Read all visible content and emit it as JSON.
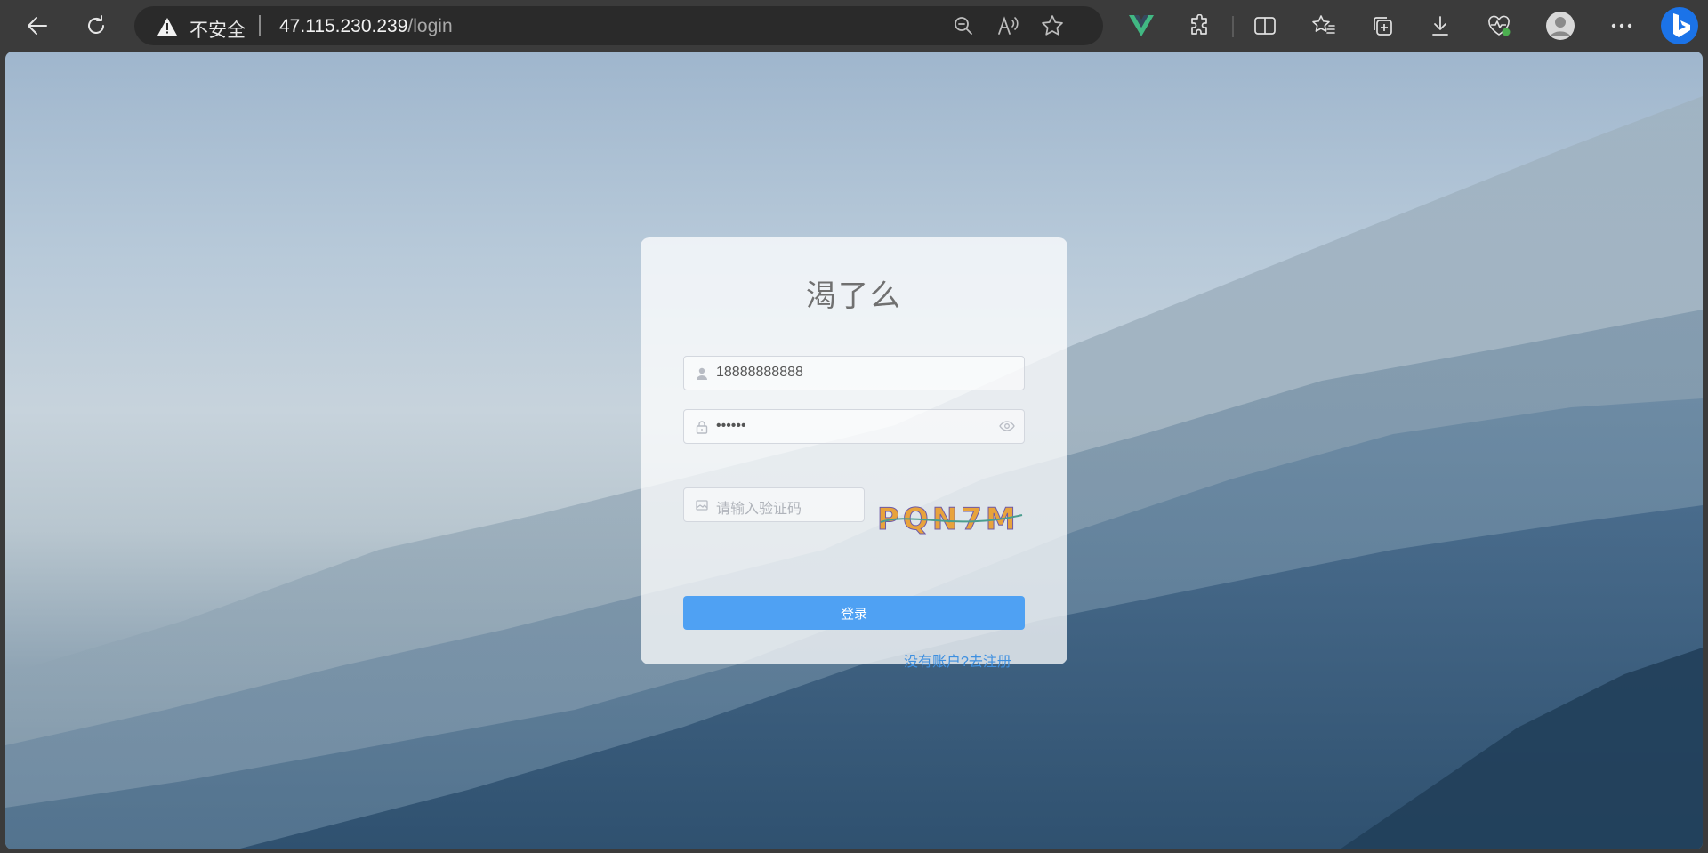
{
  "browser": {
    "security_label": "不安全",
    "url_host": "47.115.230.239",
    "url_path": "/login"
  },
  "login": {
    "title": "渴了么",
    "username_value": "18888888888",
    "password_value": "••••••",
    "captcha_placeholder": "请输入验证码",
    "captcha_text": "PQN7M",
    "login_button": "登录",
    "register_link": "没有账户?去注册"
  },
  "colors": {
    "primary": "#4fa1f3",
    "link": "#3d8fe0",
    "vue_logo": "#41b883"
  },
  "icons": [
    "back-arrow-icon",
    "refresh-icon",
    "warning-icon",
    "zoom-out-icon",
    "read-aloud-icon",
    "favorite-star-icon",
    "vue-devtools-icon",
    "extensions-icon",
    "split-screen-icon",
    "favorites-icon",
    "collections-icon",
    "download-icon",
    "browser-essentials-icon",
    "profile-avatar-icon",
    "more-icon",
    "bing-copilot-icon",
    "user-icon",
    "lock-icon",
    "eye-icon",
    "picture-icon"
  ]
}
